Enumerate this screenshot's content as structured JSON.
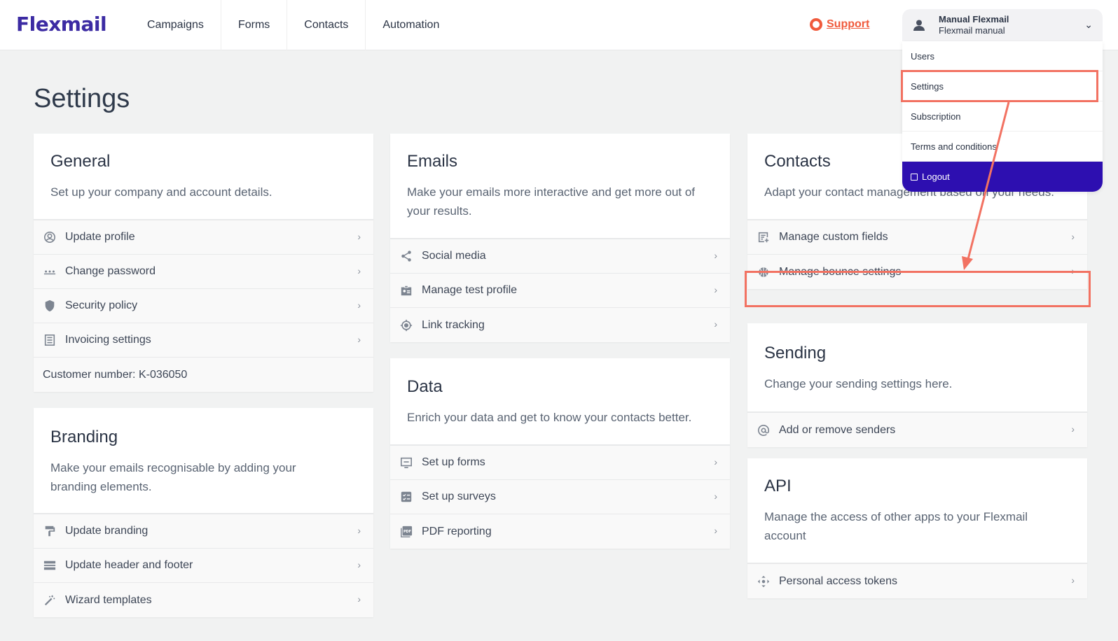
{
  "app": {
    "logo": "Flexmail"
  },
  "nav": {
    "items": [
      "Campaigns",
      "Forms",
      "Contacts",
      "Automation"
    ]
  },
  "support": {
    "label": "Support"
  },
  "user": {
    "name": "Manual Flexmail",
    "account": "Flexmail manual",
    "menu": [
      "Users",
      "Settings",
      "Subscription",
      "Terms and conditions",
      "Logout"
    ]
  },
  "page": {
    "title": "Settings"
  },
  "general": {
    "title": "General",
    "desc": "Set up your company and account details.",
    "items": [
      "Update profile",
      "Change password",
      "Security policy",
      "Invoicing settings"
    ],
    "customer_number": "Customer number: K-036050"
  },
  "branding": {
    "title": "Branding",
    "desc": "Make your emails recognisable by adding your branding elements.",
    "items": [
      "Update branding",
      "Update header and footer",
      "Wizard templates"
    ]
  },
  "emails": {
    "title": "Emails",
    "desc": "Make your emails more interactive and get more out of your results.",
    "items": [
      "Social media",
      "Manage test profile",
      "Link tracking"
    ]
  },
  "data": {
    "title": "Data",
    "desc": "Enrich your data and get to know your contacts better.",
    "items": [
      "Set up forms",
      "Set up surveys",
      "PDF reporting"
    ]
  },
  "contacts": {
    "title": "Contacts",
    "desc": "Adapt your contact management based on your needs.",
    "items": [
      "Manage custom fields",
      "Manage bounce settings"
    ]
  },
  "sending": {
    "title": "Sending",
    "desc": "Change your sending settings here.",
    "items": [
      "Add or remove senders"
    ]
  },
  "api": {
    "title": "API",
    "desc": "Manage the access of other apps to your Flexmail account",
    "items": [
      "Personal access tokens"
    ]
  },
  "colors": {
    "brand": "#3c2ba3",
    "accent": "#f05a3c",
    "highlight": "#f27262",
    "logout_bg": "#2d0fb0"
  }
}
